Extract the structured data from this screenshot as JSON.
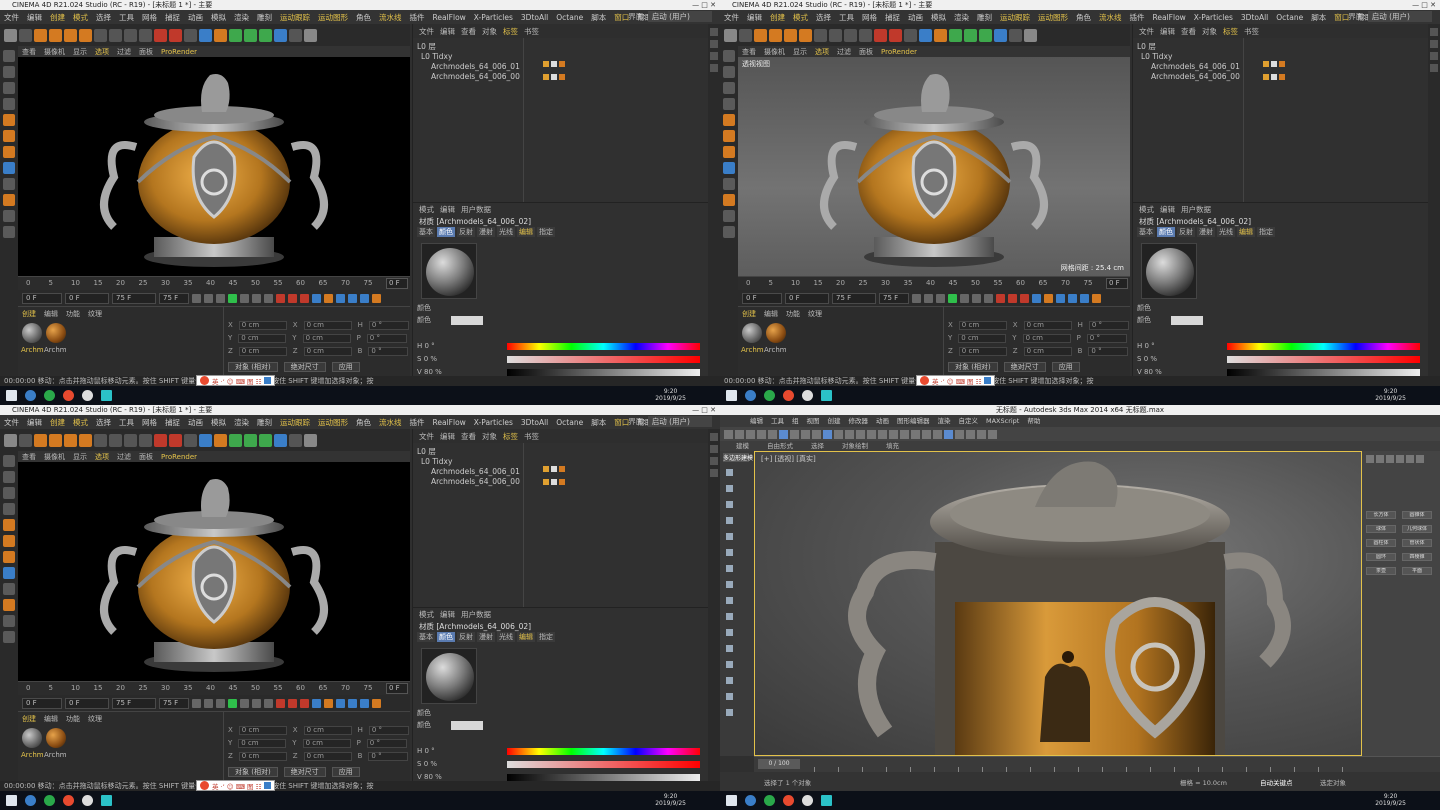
{
  "c4d": {
    "title": "CINEMA 4D R21.024 Studio (RC - R19) - [未标题 1 *] - 主要",
    "menu": [
      "文件",
      "编辑",
      "创建",
      "模式",
      "选择",
      "工具",
      "网格",
      "捕捉",
      "动画",
      "模拟",
      "渲染",
      "雕刻",
      "运动跟踪",
      "运动图形",
      "角色",
      "流水线",
      "插件",
      "RealFlow",
      "X-Particles",
      "3DtoAll",
      "Octane",
      "脚本",
      "窗口",
      "帮助"
    ],
    "layout_label": "界面:",
    "layout_value": "启动 (用户)",
    "viewport_menu": [
      "查看",
      "摄像机",
      "显示",
      "选项",
      "过滤",
      "面板",
      "ProRender"
    ],
    "viewport_label_persp": "透视视图",
    "grid_spacing": "网格间距 : 25.4 cm",
    "timeline_ticks": [
      "0",
      "5",
      "10",
      "15",
      "20",
      "25",
      "30",
      "35",
      "40",
      "45",
      "50",
      "55",
      "60",
      "65",
      "70",
      "75"
    ],
    "timeline_frame": "0 F",
    "transport": {
      "start": "0 F",
      "min": "0 F",
      "end": "75 F",
      "max": "75 F"
    },
    "material_manager": {
      "menu": [
        "创建",
        "编辑",
        "功能",
        "纹理"
      ],
      "materials": [
        "Archm",
        "Archm"
      ]
    },
    "coords": {
      "rows": [
        {
          "a": "X",
          "av": "0 cm",
          "b": "X",
          "bv": "0 cm",
          "c": "H",
          "cv": "0 °"
        },
        {
          "a": "Y",
          "av": "0 cm",
          "b": "Y",
          "bv": "0 cm",
          "c": "P",
          "cv": "0 °"
        },
        {
          "a": "Z",
          "av": "0 cm",
          "b": "Z",
          "bv": "0 cm",
          "c": "B",
          "cv": "0 °"
        }
      ],
      "mode1": "对象 (相对)",
      "mode2": "绝对尺寸",
      "apply": "应用"
    },
    "status": "00:00:00  移动：点击并拖动鼠标移动元素。按住 SHIFT 键量化移动；节点编辑模式时按住 SHIFT 键增加选择对象；按",
    "object_manager": {
      "menu": [
        "文件",
        "编辑",
        "查看",
        "对象",
        "标签",
        "书签"
      ],
      "tree": [
        "L0 层",
        "L0 Tidxy",
        "Archmodels_64_006_01",
        "Archmodels_64_006_00"
      ]
    },
    "attributes": {
      "menu": [
        "模式",
        "编辑",
        "用户数据"
      ],
      "material_name": "材质 [Archmodels_64_006_02]",
      "tabs": [
        "基本",
        "颜色",
        "反射",
        "漫射",
        "光线",
        "编辑",
        "指定"
      ],
      "color_section": "颜色",
      "color_label": "颜色",
      "h": {
        "label": "H",
        "value": "0 °"
      },
      "s": {
        "label": "S",
        "value": "0 %"
      },
      "v": {
        "label": "V",
        "value": "80 %"
      }
    }
  },
  "taskbar": {
    "time": "9:20",
    "date": "2019/9/25"
  },
  "stamp": {
    "text": "英 ·’ ☺ ⌨ 图 ☷"
  },
  "max": {
    "title": "无标题 - Autodesk 3ds Max 2014 x64     无标题.max",
    "menu": [
      "编辑",
      "工具",
      "组",
      "视图",
      "创建",
      "修改器",
      "动画",
      "图形编辑器",
      "渲染",
      "自定义",
      "MAXScript",
      "帮助"
    ],
    "ribbon": [
      "建模",
      "自由形式",
      "选择",
      "对象绘制",
      "填充"
    ],
    "left_label": "多边形建模",
    "viewport_label": "[+] [透视] [真实]",
    "timeline_label": "0 / 100",
    "status_left": "选择了 1 个对象",
    "status_grid": "栅格 = 10.0cm",
    "status_key": "自动关键点",
    "status_sel": "选定对象",
    "cmd_buttons": [
      "长方体",
      "圆锥体",
      "球体",
      "几何球体",
      "圆柱体",
      "管状体",
      "圆环",
      "四棱锥",
      "茶壶",
      "平面"
    ]
  }
}
